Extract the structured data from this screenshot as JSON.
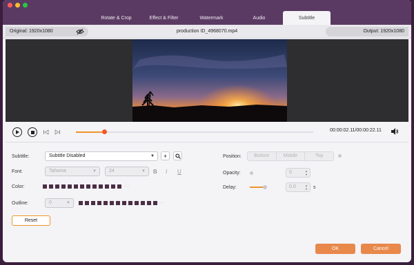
{
  "tabs": [
    {
      "label": "Rotate & Crop"
    },
    {
      "label": "Effect & Filter"
    },
    {
      "label": "Watermark"
    },
    {
      "label": "Audio"
    },
    {
      "label": "Subtitle"
    }
  ],
  "active_tab": "Subtitle",
  "infobar": {
    "original": "Original: 1920x1080",
    "filename": "production ID_4968070.mp4",
    "output": "Output: 1920x1080"
  },
  "playback": {
    "time": "00:00:02.11/00:00:22.11",
    "progress_fraction": 0.12
  },
  "subtitle": {
    "label": "Subtitle:",
    "value": "Subtitle Disabled",
    "add_symbol": "+"
  },
  "font": {
    "label": "Font:",
    "family": "Tahoma",
    "size": "24",
    "bold": "B",
    "italic": "I",
    "underline": "U"
  },
  "color": {
    "label": "Color:",
    "more": "···",
    "swatch_color": "#4a2e44"
  },
  "outline": {
    "label": "Outline:",
    "value": "0",
    "more": "···"
  },
  "reset_label": "Reset",
  "position": {
    "label": "Position:",
    "options": [
      "Bottom",
      "Middle",
      "Top"
    ]
  },
  "opacity": {
    "label": "Opacity:",
    "value": "0"
  },
  "delay": {
    "label": "Delay:",
    "value": "0.0",
    "unit": "s"
  },
  "buttons": {
    "ok": "OK",
    "cancel": "Cancel"
  },
  "colors": {
    "accent": "#f0932b",
    "button": "#e8884a",
    "titlebar": "#5a3a63"
  }
}
